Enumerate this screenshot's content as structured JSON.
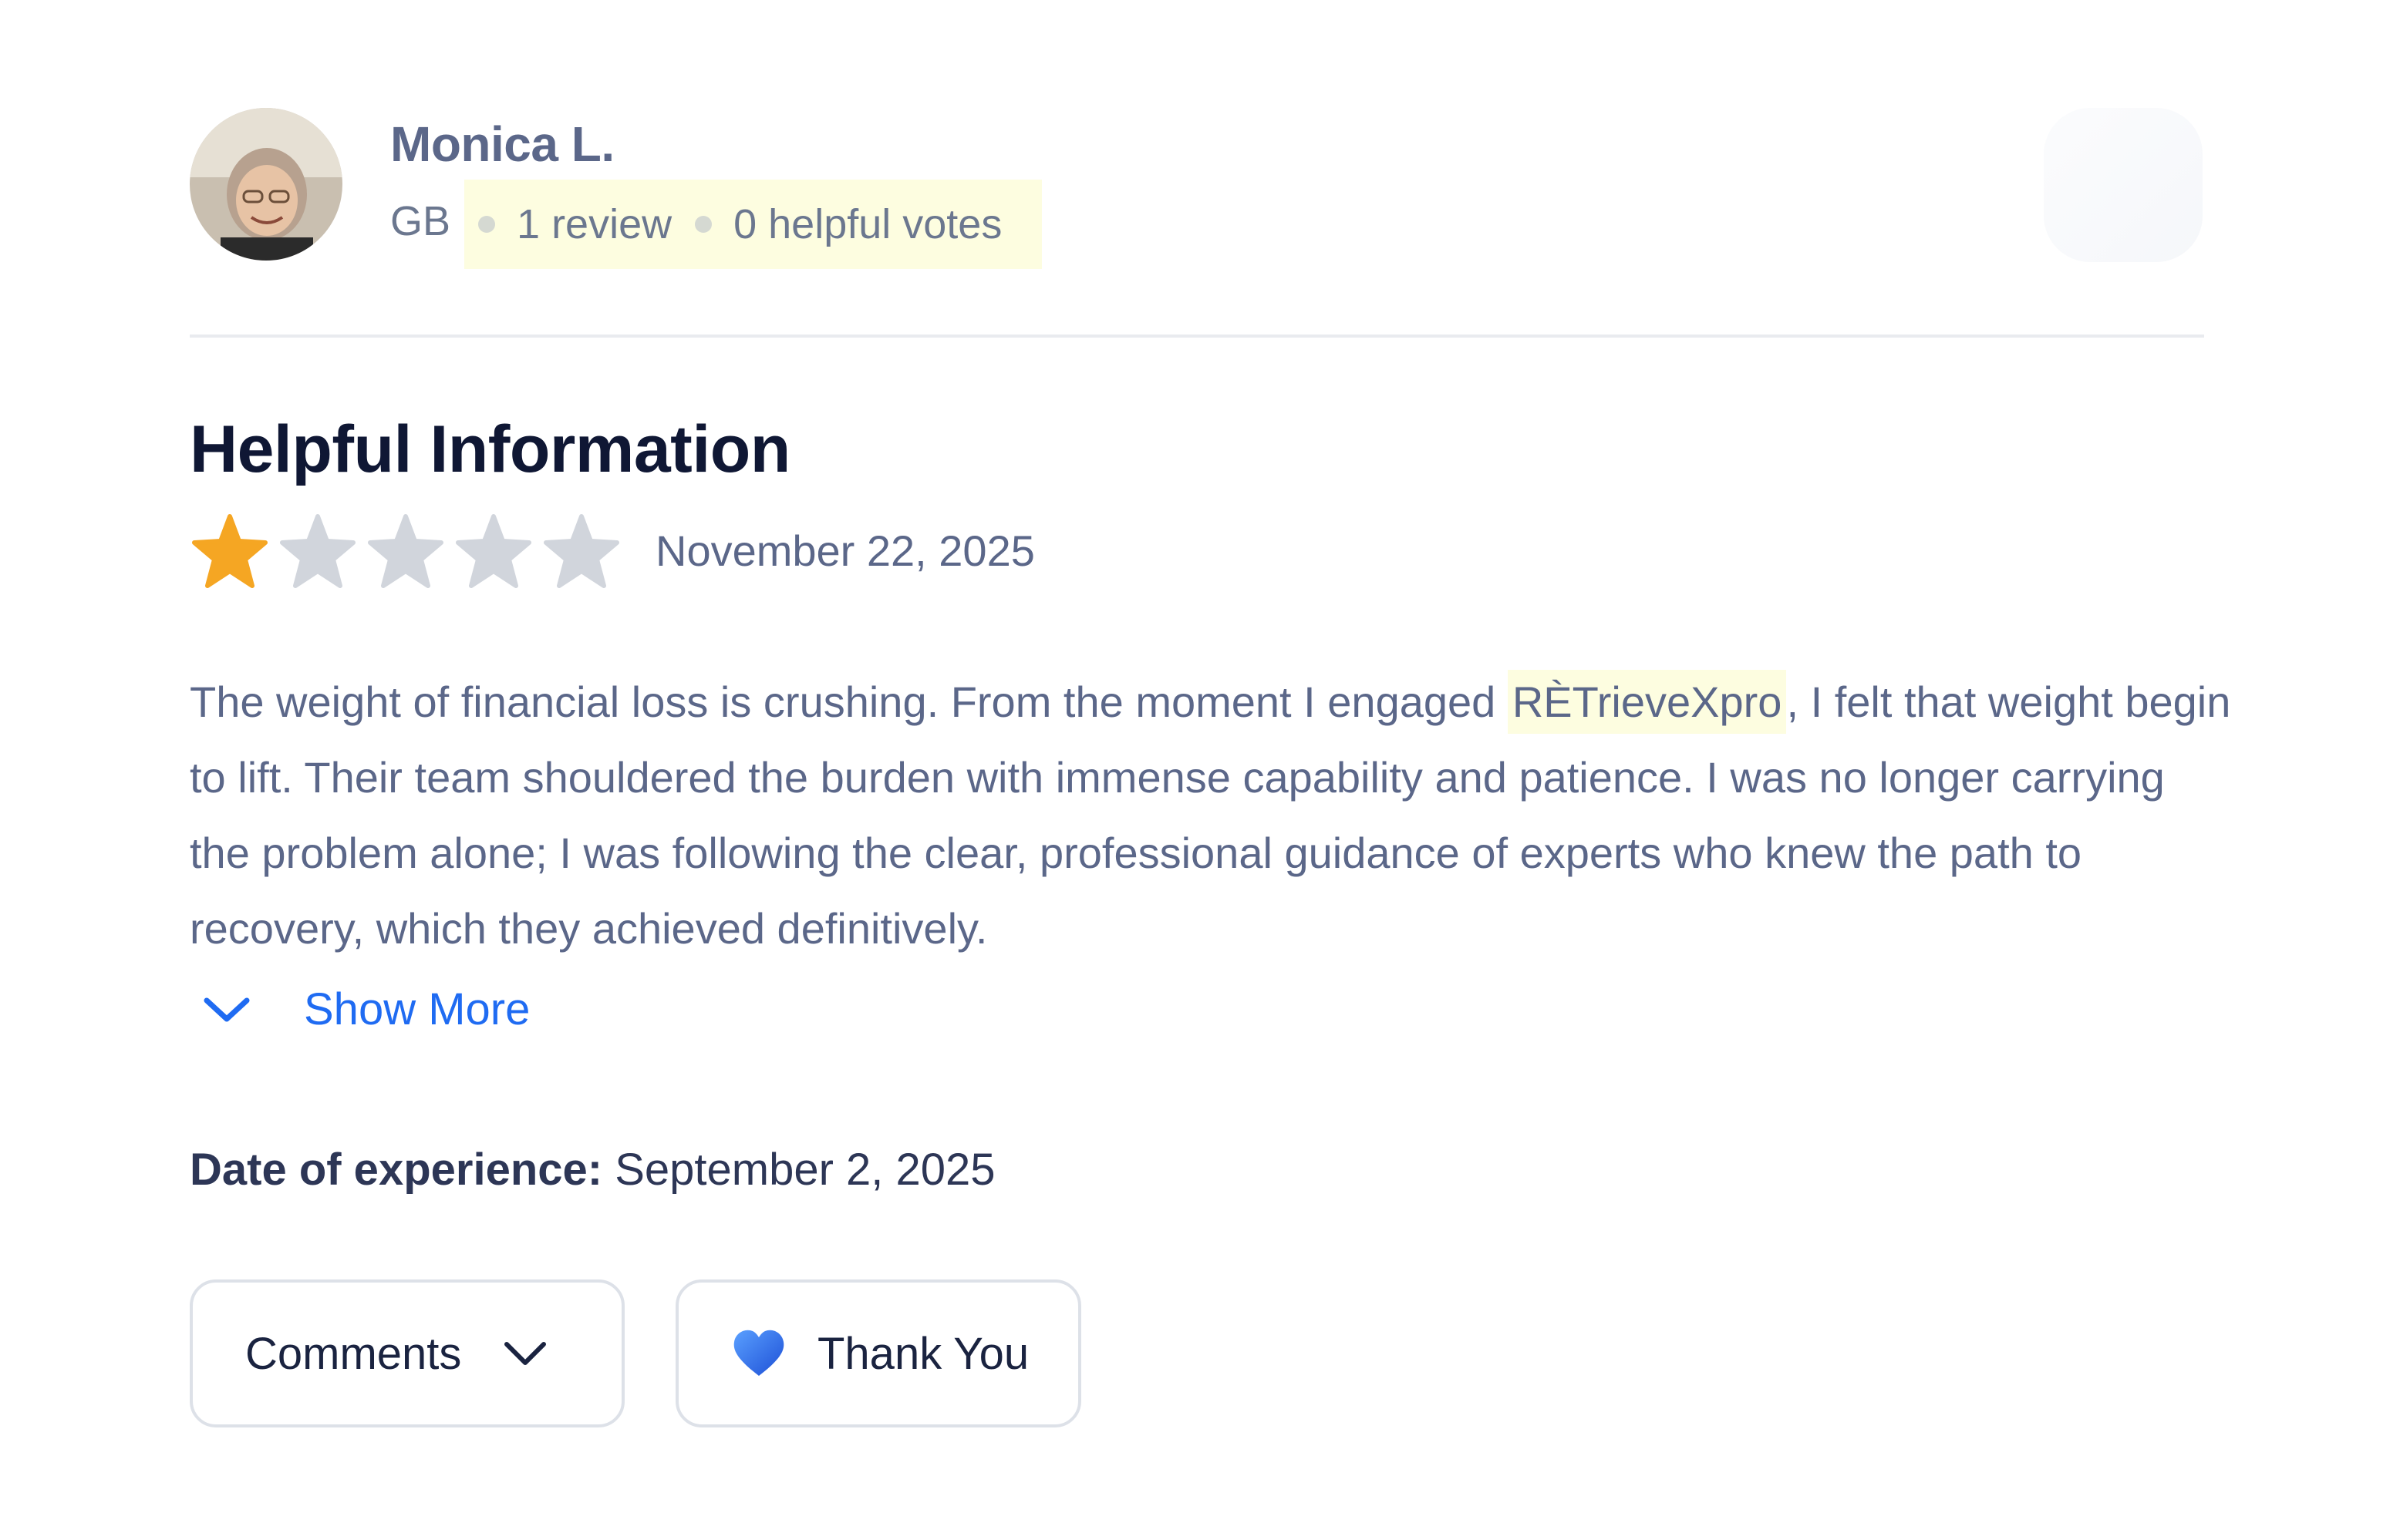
{
  "reviewer": {
    "name": "Monica L.",
    "country": "GB",
    "reviews": "1 review",
    "helpful_votes": "0 helpful votes"
  },
  "review": {
    "title": "Helpful Information",
    "rating": 1,
    "rating_max": 5,
    "date": "November 22, 2025",
    "body_part1": "The weight of financial loss is crushing. From the moment I engaged ",
    "brand": "RÈTrieveXpro",
    "body_part2": ", I felt that weight begin to lift. Their team shouldered the burden with immense capability and patience. I was no longer carrying the problem alone; I was following the clear, professional guidance of experts who knew the path to recovery, which they achieved definitively.",
    "show_more_label": "Show More",
    "experience_label": "Date of experience:",
    "experience_date": "September 2, 2025"
  },
  "actions": {
    "comments_label": "Comments",
    "thanks_label": "Thank You"
  },
  "icons": {
    "star_filled": "star-filled-icon",
    "star_empty": "star-empty-icon",
    "chevron": "chevron-down-icon",
    "heart": "heart-icon"
  },
  "colors": {
    "star_filled": "#f5a623",
    "star_empty": "#d1d5dc",
    "link": "#1f6bf2",
    "highlight": "#fdfde0",
    "heart": "#2f6cf0"
  }
}
